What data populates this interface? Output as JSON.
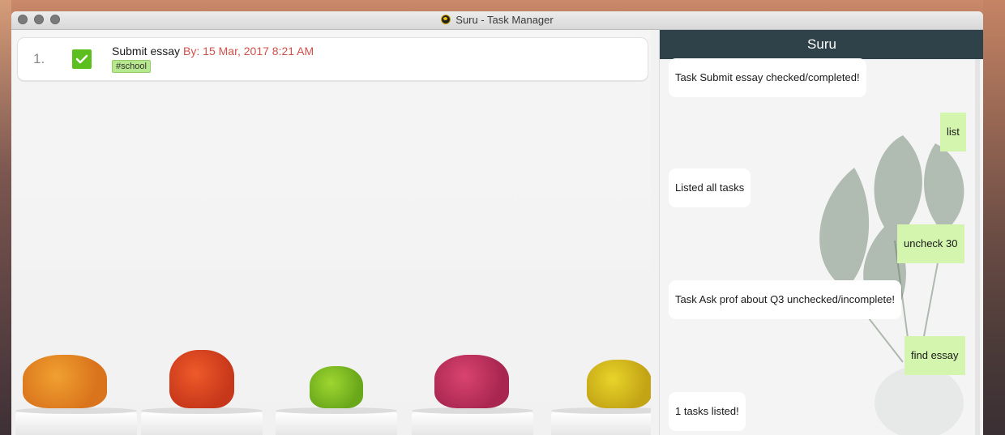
{
  "window": {
    "title": "Suru - Task Manager",
    "app_icon": "suru-app-icon"
  },
  "tasks": [
    {
      "index": "1.",
      "title": "Submit essay",
      "date": "By: 15 Mar, 2017 8:21 AM",
      "tag": "#school",
      "completed": true
    }
  ],
  "chat": {
    "header": "Suru",
    "messages": [
      {
        "from": "bot",
        "text": "Task Submit essay checked/completed!"
      },
      {
        "from": "user",
        "text": "list"
      },
      {
        "from": "bot",
        "text": "Listed all tasks"
      },
      {
        "from": "user",
        "text": "uncheck 30"
      },
      {
        "from": "bot",
        "text": "Task Ask prof about Q3 unchecked/incomplete!"
      },
      {
        "from": "user",
        "text": "find essay"
      },
      {
        "from": "bot",
        "text": "1 tasks listed!"
      }
    ]
  },
  "colors": {
    "header": "#2f4149",
    "user_bubble": "#d3f5ad",
    "check": "#5cbf1f",
    "date": "#d0504a",
    "tag": "#b7e78e"
  }
}
